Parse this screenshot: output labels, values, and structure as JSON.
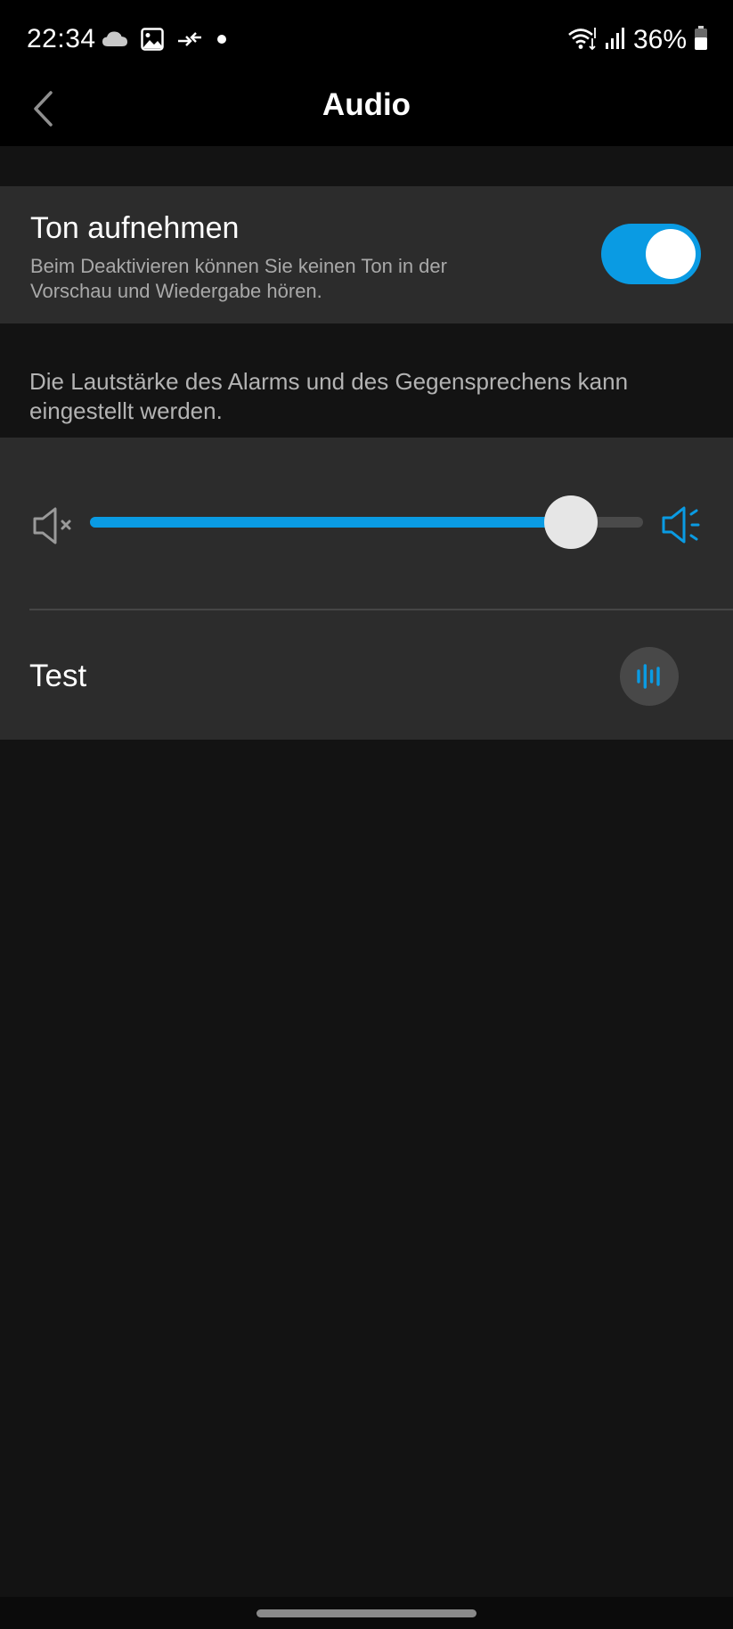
{
  "status_bar": {
    "time": "22:34",
    "battery_percent": "36%",
    "icons_left": [
      "cloud-icon",
      "gallery-icon",
      "data-transfer-icon",
      "notification-dot-icon"
    ],
    "icons_right": [
      "wifi-icon",
      "signal-icon",
      "battery-icon"
    ]
  },
  "header": {
    "title": "Audio",
    "back_icon": "chevron-left-icon"
  },
  "record_audio": {
    "title": "Ton aufnehmen",
    "description": "Beim Deaktivieren können Sie keinen Ton in der Vorschau und Wiedergabe hören.",
    "enabled": true
  },
  "volume": {
    "description": "Die Lautstärke des Alarms und des Gegensprechens kann eingestellt werden.",
    "level_fraction": 0.87,
    "min_icon": "speaker-mute-icon",
    "max_icon": "speaker-loud-icon"
  },
  "test": {
    "label": "Test",
    "icon": "sound-wave-icon"
  },
  "colors": {
    "accent": "#0a9be3",
    "background": "#131313",
    "card": "#2c2c2c",
    "bar": "#000000"
  }
}
